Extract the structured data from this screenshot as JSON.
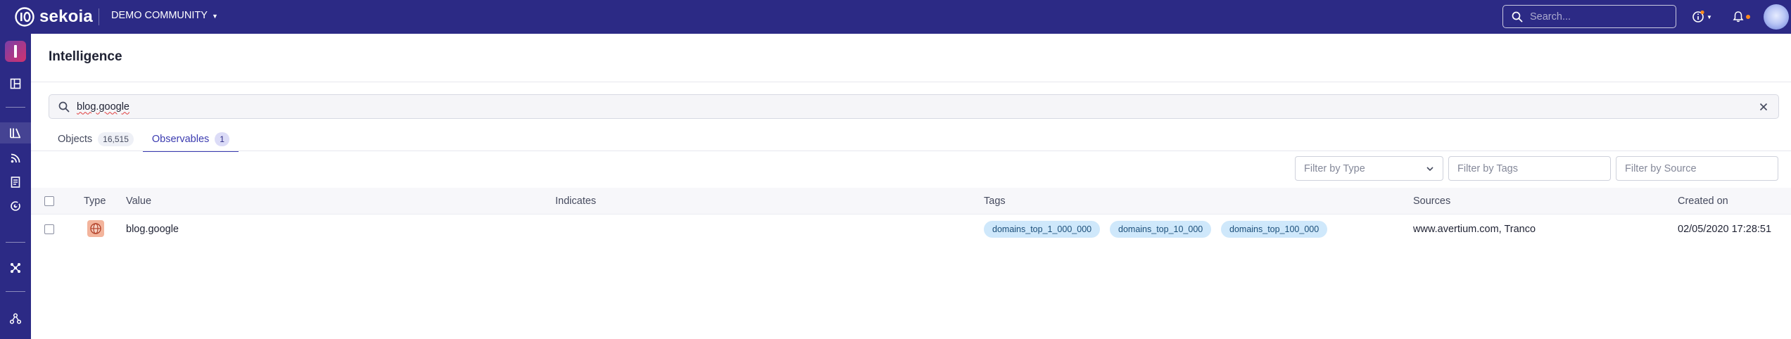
{
  "header": {
    "brand": "sekoia",
    "community": "DEMO COMMUNITY",
    "search_placeholder": "Search...",
    "colors": {
      "bar": "#2c2a85",
      "notification_dot": "#ff8a1c"
    }
  },
  "sidebar": {
    "items": [
      {
        "name": "app-switcher",
        "icon": "app-icon"
      },
      {
        "name": "dashboards",
        "icon": "dashboard-icon"
      },
      {
        "name": "intelligence",
        "icon": "library-icon",
        "active": true
      },
      {
        "name": "feeds",
        "icon": "rss-icon"
      },
      {
        "name": "reports",
        "icon": "document-icon"
      },
      {
        "name": "threat-map",
        "icon": "radar-icon"
      },
      {
        "name": "graph",
        "icon": "graph-icon"
      },
      {
        "name": "community",
        "icon": "org-icon"
      }
    ]
  },
  "page": {
    "title": "Intelligence",
    "search_value": "blog.google"
  },
  "tabs": [
    {
      "label": "Objects",
      "count": "16,515",
      "active": false
    },
    {
      "label": "Observables",
      "count": "1",
      "active": true
    }
  ],
  "filters": {
    "type_placeholder": "Filter by Type",
    "tags_placeholder": "Filter by Tags",
    "source_placeholder": "Filter by Source"
  },
  "table": {
    "columns": [
      "Type",
      "Value",
      "Indicates",
      "Tags",
      "Sources",
      "Created on"
    ],
    "rows": [
      {
        "type_icon": "globe-icon",
        "value": "blog.google",
        "indicates": "",
        "tags": [
          "domains_top_1_000_000",
          "domains_top_10_000",
          "domains_top_100_000"
        ],
        "sources": "www.avertium.com, Tranco",
        "created_on": "02/05/2020 17:28:51"
      }
    ]
  }
}
